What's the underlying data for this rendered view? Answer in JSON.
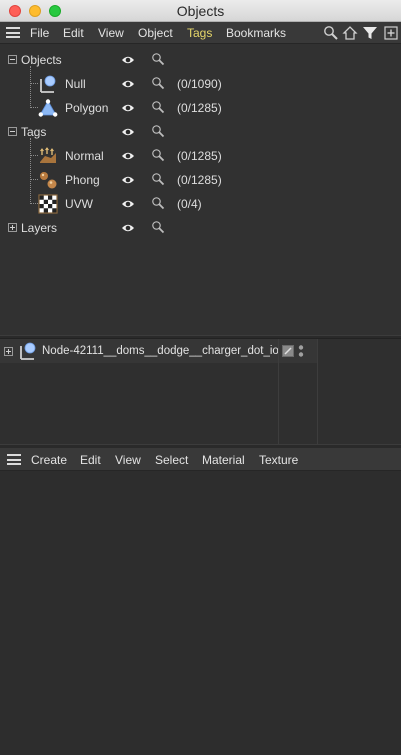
{
  "window": {
    "title": "Objects"
  },
  "menubar": {
    "items": [
      "File",
      "Edit",
      "View",
      "Object",
      "Tags",
      "Bookmarks"
    ],
    "active": "Tags",
    "active_color": "#e7d86a",
    "icons": [
      "search-icon",
      "home-icon",
      "filter-icon",
      "new-window-icon"
    ]
  },
  "tree": {
    "objects": {
      "label": "Objects",
      "children": [
        {
          "label": "Null",
          "count": "(0/1090)",
          "icon": "null-object-icon"
        },
        {
          "label": "Polygon",
          "count": "(0/1285)",
          "icon": "polygon-object-icon"
        }
      ]
    },
    "tags": {
      "label": "Tags",
      "children": [
        {
          "label": "Normal",
          "count": "(0/1285)",
          "icon": "normal-tag-icon"
        },
        {
          "label": "Phong",
          "count": "(0/1285)",
          "icon": "phong-tag-icon"
        },
        {
          "label": "UVW",
          "count": "(0/4)",
          "icon": "uvw-tag-icon"
        }
      ]
    },
    "layers": {
      "label": "Layers"
    }
  },
  "layer_panel": {
    "node": {
      "label": "Node-42111__doms__dodge__charger_dot_io",
      "icon": "null-object-icon"
    }
  },
  "material_bar": {
    "items": [
      "Create",
      "Edit",
      "View",
      "Select",
      "Material",
      "Texture"
    ]
  }
}
